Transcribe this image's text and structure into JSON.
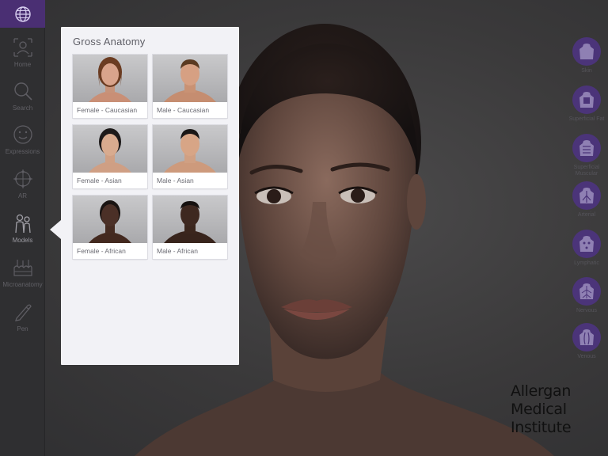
{
  "sidebar": {
    "items": [
      {
        "label": "Home",
        "icon": "home-icon"
      },
      {
        "label": "Search",
        "icon": "search-icon"
      },
      {
        "label": "Expressions",
        "icon": "smiley-icon"
      },
      {
        "label": "AR",
        "icon": "ar-icon"
      },
      {
        "label": "Models",
        "icon": "people-icon"
      },
      {
        "label": "Microanatomy",
        "icon": "microanatomy-icon"
      },
      {
        "label": "Pen",
        "icon": "pen-icon"
      }
    ],
    "active_item": "Models"
  },
  "popover": {
    "title": "Gross Anatomy",
    "models": [
      {
        "label": "Female - Caucasian",
        "skin": "#d9a48c",
        "hair": "#6b3c22"
      },
      {
        "label": "Male - Caucasian",
        "skin": "#d6a083",
        "hair": "#5a3a22"
      },
      {
        "label": "Female - Asian",
        "skin": "#d8ab8f",
        "hair": "#1d1a1a"
      },
      {
        "label": "Male - Asian",
        "skin": "#d7a586",
        "hair": "#1a1716"
      },
      {
        "label": "Female - African",
        "skin": "#4b3027",
        "hair": "#1a1412"
      },
      {
        "label": "Male - African",
        "skin": "#3e2820",
        "hair": "#161110"
      }
    ]
  },
  "layers": {
    "items": [
      {
        "label": "Skin",
        "icon": "skin-layer-icon"
      },
      {
        "label": "Superficial Fat",
        "icon": "fat-layer-icon"
      },
      {
        "label": "Superficial Muscular",
        "icon": "muscle-layer-icon"
      },
      {
        "label": "Arterial",
        "icon": "arterial-layer-icon"
      },
      {
        "label": "Lymphatic",
        "icon": "lymphatic-layer-icon"
      },
      {
        "label": "Nervous",
        "icon": "nervous-layer-icon"
      },
      {
        "label": "Venous",
        "icon": "venous-layer-icon"
      }
    ]
  },
  "brand": {
    "line1": "Allergan",
    "line2": "Medical",
    "line3": "Institute"
  },
  "colors": {
    "accent": "#4a2f73",
    "layer_button": "#4b3479",
    "popover_bg": "#f2f2f6"
  }
}
